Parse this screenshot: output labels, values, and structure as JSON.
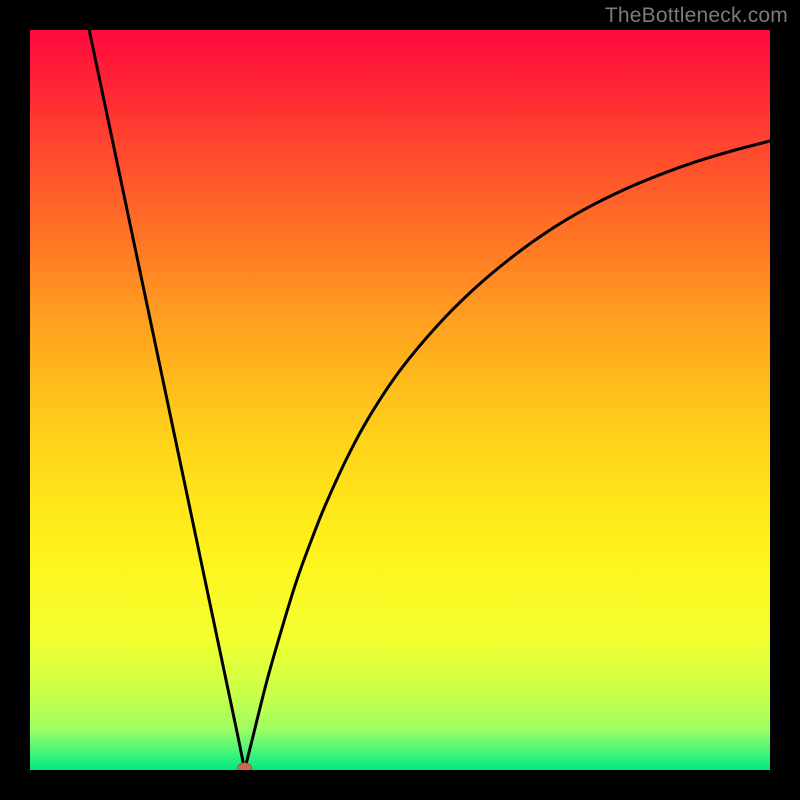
{
  "watermark": "TheBottleneck.com",
  "colors": {
    "frame": "#000000",
    "curve": "#000000",
    "marker_fill": "#c96a57",
    "marker_stroke": "#b05242",
    "gradient_stops": [
      {
        "offset": 0.0,
        "color": "#ff0a3e"
      },
      {
        "offset": 0.1,
        "color": "#ff2f33"
      },
      {
        "offset": 0.25,
        "color": "#ff6a27"
      },
      {
        "offset": 0.4,
        "color": "#ffa21f"
      },
      {
        "offset": 0.55,
        "color": "#ffd21a"
      },
      {
        "offset": 0.7,
        "color": "#fff21b"
      },
      {
        "offset": 0.82,
        "color": "#f4ff2f"
      },
      {
        "offset": 0.9,
        "color": "#c8ff4a"
      },
      {
        "offset": 0.945,
        "color": "#9cff62"
      },
      {
        "offset": 0.975,
        "color": "#48f57a"
      },
      {
        "offset": 1.0,
        "color": "#00e97d"
      }
    ]
  },
  "chart_data": {
    "type": "line",
    "title": "",
    "xlabel": "",
    "ylabel": "",
    "xlim": [
      0,
      100
    ],
    "ylim": [
      0,
      100
    ],
    "marker": {
      "x": 29,
      "y": 0
    },
    "series": [
      {
        "name": "left-branch",
        "x": [
          8,
          10,
          12,
          14,
          16,
          18,
          20,
          22,
          24,
          26,
          28,
          29
        ],
        "y": [
          100,
          90.5,
          81,
          71.5,
          62,
          52.5,
          43,
          33.5,
          24,
          14.5,
          5,
          0
        ]
      },
      {
        "name": "right-branch",
        "x": [
          29,
          30,
          32,
          34,
          36,
          38,
          40,
          43,
          46,
          50,
          55,
          60,
          65,
          70,
          75,
          80,
          85,
          90,
          95,
          100
        ],
        "y": [
          0,
          4,
          12,
          19,
          25.5,
          31,
          36,
          42.5,
          48,
          54,
          60,
          65,
          69.2,
          72.8,
          75.8,
          78.3,
          80.4,
          82.2,
          83.7,
          85
        ]
      }
    ]
  }
}
